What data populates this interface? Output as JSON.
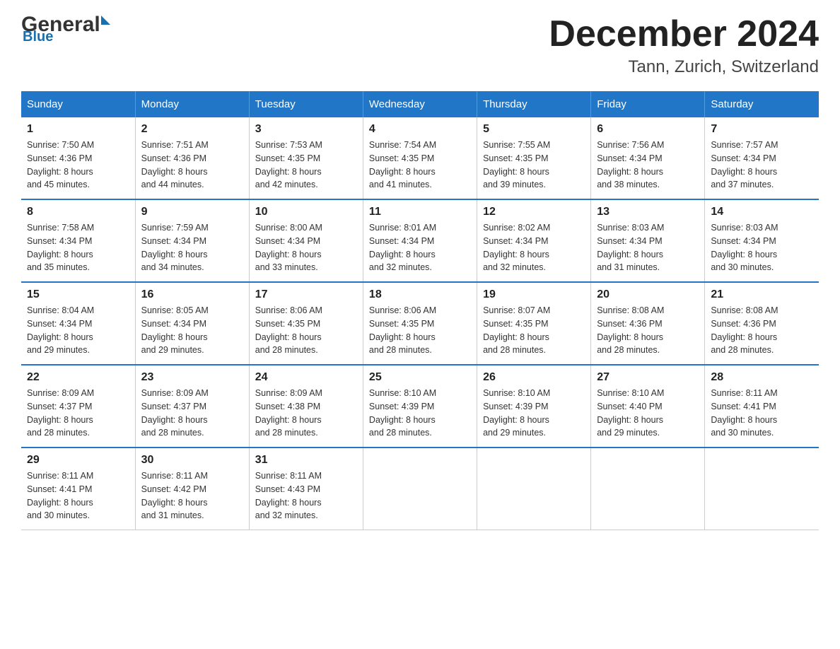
{
  "header": {
    "logo_general": "General",
    "logo_blue": "Blue",
    "month_year": "December 2024",
    "location": "Tann, Zurich, Switzerland"
  },
  "days_of_week": [
    "Sunday",
    "Monday",
    "Tuesday",
    "Wednesday",
    "Thursday",
    "Friday",
    "Saturday"
  ],
  "weeks": [
    [
      {
        "day": "1",
        "sunrise": "7:50 AM",
        "sunset": "4:36 PM",
        "daylight": "8 hours and 45 minutes."
      },
      {
        "day": "2",
        "sunrise": "7:51 AM",
        "sunset": "4:36 PM",
        "daylight": "8 hours and 44 minutes."
      },
      {
        "day": "3",
        "sunrise": "7:53 AM",
        "sunset": "4:35 PM",
        "daylight": "8 hours and 42 minutes."
      },
      {
        "day": "4",
        "sunrise": "7:54 AM",
        "sunset": "4:35 PM",
        "daylight": "8 hours and 41 minutes."
      },
      {
        "day": "5",
        "sunrise": "7:55 AM",
        "sunset": "4:35 PM",
        "daylight": "8 hours and 39 minutes."
      },
      {
        "day": "6",
        "sunrise": "7:56 AM",
        "sunset": "4:34 PM",
        "daylight": "8 hours and 38 minutes."
      },
      {
        "day": "7",
        "sunrise": "7:57 AM",
        "sunset": "4:34 PM",
        "daylight": "8 hours and 37 minutes."
      }
    ],
    [
      {
        "day": "8",
        "sunrise": "7:58 AM",
        "sunset": "4:34 PM",
        "daylight": "8 hours and 35 minutes."
      },
      {
        "day": "9",
        "sunrise": "7:59 AM",
        "sunset": "4:34 PM",
        "daylight": "8 hours and 34 minutes."
      },
      {
        "day": "10",
        "sunrise": "8:00 AM",
        "sunset": "4:34 PM",
        "daylight": "8 hours and 33 minutes."
      },
      {
        "day": "11",
        "sunrise": "8:01 AM",
        "sunset": "4:34 PM",
        "daylight": "8 hours and 32 minutes."
      },
      {
        "day": "12",
        "sunrise": "8:02 AM",
        "sunset": "4:34 PM",
        "daylight": "8 hours and 32 minutes."
      },
      {
        "day": "13",
        "sunrise": "8:03 AM",
        "sunset": "4:34 PM",
        "daylight": "8 hours and 31 minutes."
      },
      {
        "day": "14",
        "sunrise": "8:03 AM",
        "sunset": "4:34 PM",
        "daylight": "8 hours and 30 minutes."
      }
    ],
    [
      {
        "day": "15",
        "sunrise": "8:04 AM",
        "sunset": "4:34 PM",
        "daylight": "8 hours and 29 minutes."
      },
      {
        "day": "16",
        "sunrise": "8:05 AM",
        "sunset": "4:34 PM",
        "daylight": "8 hours and 29 minutes."
      },
      {
        "day": "17",
        "sunrise": "8:06 AM",
        "sunset": "4:35 PM",
        "daylight": "8 hours and 28 minutes."
      },
      {
        "day": "18",
        "sunrise": "8:06 AM",
        "sunset": "4:35 PM",
        "daylight": "8 hours and 28 minutes."
      },
      {
        "day": "19",
        "sunrise": "8:07 AM",
        "sunset": "4:35 PM",
        "daylight": "8 hours and 28 minutes."
      },
      {
        "day": "20",
        "sunrise": "8:08 AM",
        "sunset": "4:36 PM",
        "daylight": "8 hours and 28 minutes."
      },
      {
        "day": "21",
        "sunrise": "8:08 AM",
        "sunset": "4:36 PM",
        "daylight": "8 hours and 28 minutes."
      }
    ],
    [
      {
        "day": "22",
        "sunrise": "8:09 AM",
        "sunset": "4:37 PM",
        "daylight": "8 hours and 28 minutes."
      },
      {
        "day": "23",
        "sunrise": "8:09 AM",
        "sunset": "4:37 PM",
        "daylight": "8 hours and 28 minutes."
      },
      {
        "day": "24",
        "sunrise": "8:09 AM",
        "sunset": "4:38 PM",
        "daylight": "8 hours and 28 minutes."
      },
      {
        "day": "25",
        "sunrise": "8:10 AM",
        "sunset": "4:39 PM",
        "daylight": "8 hours and 28 minutes."
      },
      {
        "day": "26",
        "sunrise": "8:10 AM",
        "sunset": "4:39 PM",
        "daylight": "8 hours and 29 minutes."
      },
      {
        "day": "27",
        "sunrise": "8:10 AM",
        "sunset": "4:40 PM",
        "daylight": "8 hours and 29 minutes."
      },
      {
        "day": "28",
        "sunrise": "8:11 AM",
        "sunset": "4:41 PM",
        "daylight": "8 hours and 30 minutes."
      }
    ],
    [
      {
        "day": "29",
        "sunrise": "8:11 AM",
        "sunset": "4:41 PM",
        "daylight": "8 hours and 30 minutes."
      },
      {
        "day": "30",
        "sunrise": "8:11 AM",
        "sunset": "4:42 PM",
        "daylight": "8 hours and 31 minutes."
      },
      {
        "day": "31",
        "sunrise": "8:11 AM",
        "sunset": "4:43 PM",
        "daylight": "8 hours and 32 minutes."
      },
      null,
      null,
      null,
      null
    ]
  ]
}
